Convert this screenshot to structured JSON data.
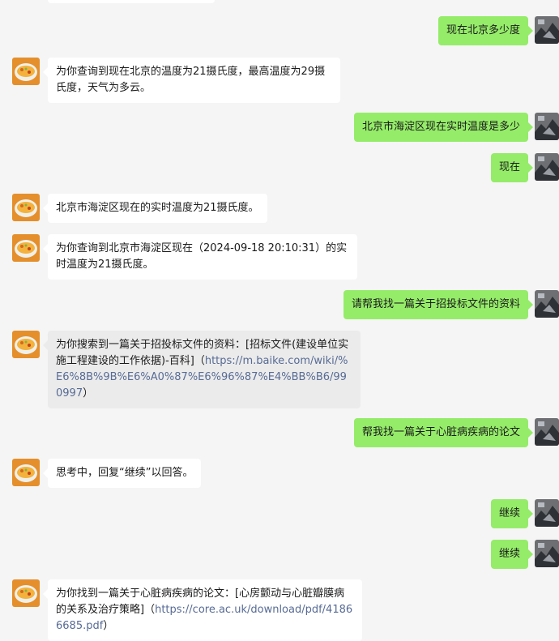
{
  "messages": [
    {
      "from": "user",
      "text": "现在北京多少度"
    },
    {
      "from": "bot",
      "text": "为你查询到现在北京的温度为21摄氏度，最高温度为29摄氏度，天气为多云。"
    },
    {
      "from": "user",
      "text": "北京市海淀区现在实时温度是多少"
    },
    {
      "from": "user",
      "text": "现在"
    },
    {
      "from": "bot",
      "text": "北京市海淀区现在的实时温度为21摄氏度。"
    },
    {
      "from": "bot",
      "text": "为你查询到北京市海淀区现在（2024-09-18 20:10:31）的实时温度为21摄氏度。"
    },
    {
      "from": "user",
      "text": "请帮我找一篇关于招投标文件的资料"
    },
    {
      "from": "bot",
      "text_before": "为你搜索到一篇关于招投标文件的资料：[招标文件(建设单位实施工程建设的工作依据)-百科]（",
      "link": "https://m.baike.com/wiki/%E6%8B%9B%E6%A0%87%E6%96%87%E4%BB%B6/990997",
      "text_after": "）"
    },
    {
      "from": "user",
      "text": "帮我找一篇关于心脏病疾病的论文"
    },
    {
      "from": "bot",
      "text": "思考中，回复“继续”以回答。"
    },
    {
      "from": "user",
      "text": "继续"
    },
    {
      "from": "user",
      "text": "继续"
    },
    {
      "from": "bot",
      "text_before": "为你找到一篇关于心脏病疾病的论文：[心房颤动与心脏瓣膜病的关系及治疗策略]（",
      "link": "https://core.ac.uk/download/pdf/41866685.pdf",
      "text_after": "）"
    }
  ]
}
